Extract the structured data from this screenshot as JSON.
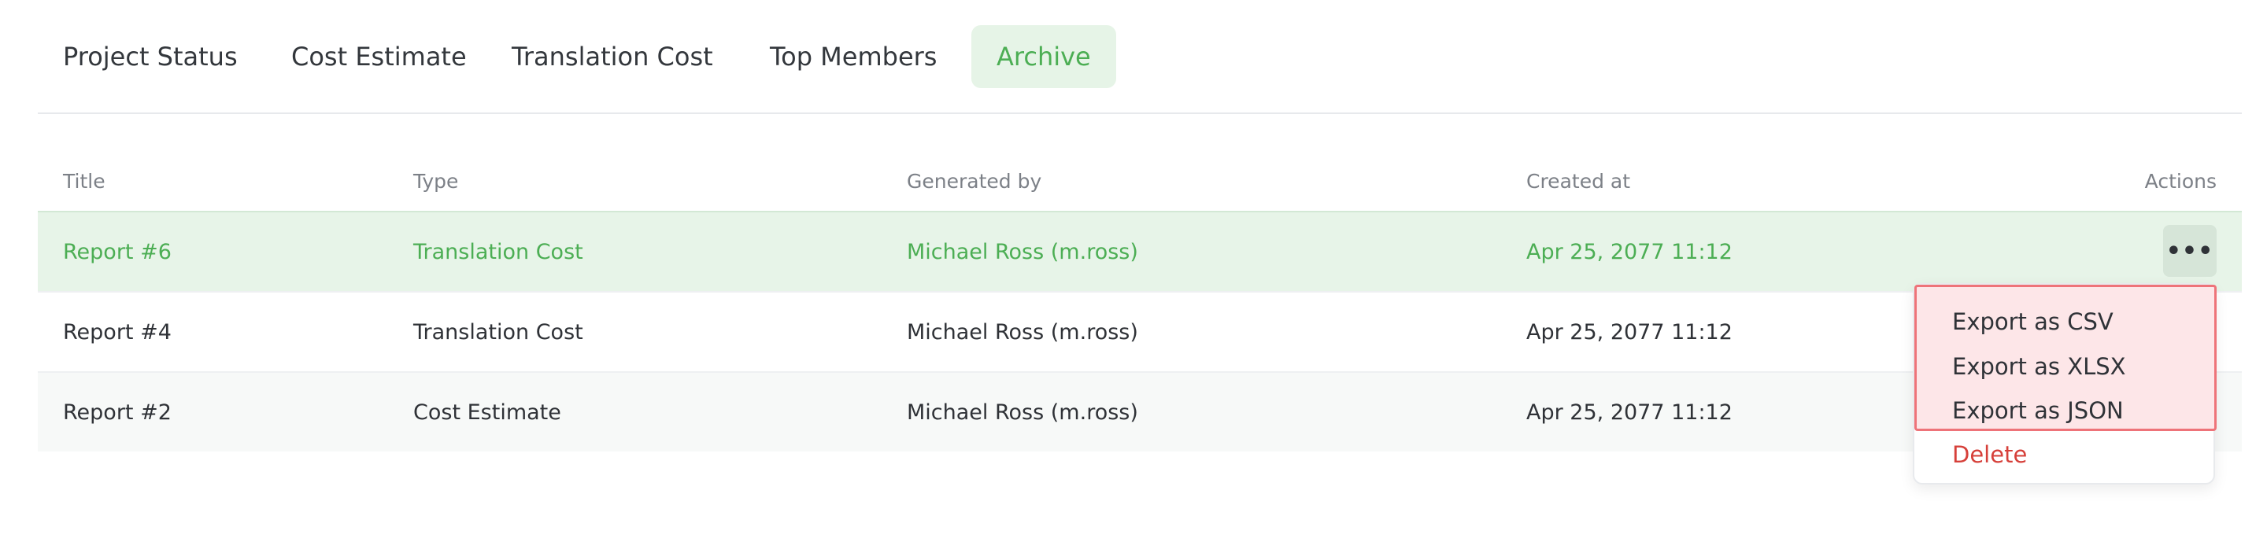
{
  "tabs": [
    {
      "label": "Project Status",
      "active": false
    },
    {
      "label": "Cost Estimate",
      "active": false
    },
    {
      "label": "Translation Cost",
      "active": false
    },
    {
      "label": "Top Members",
      "active": false
    },
    {
      "label": "Archive",
      "active": true
    }
  ],
  "table": {
    "columns": {
      "title": "Title",
      "type": "Type",
      "generated_by": "Generated by",
      "created_at": "Created at",
      "actions": "Actions"
    },
    "rows": [
      {
        "title": "Report #6",
        "type": "Translation Cost",
        "generated_by": "Michael Ross (m.ross)",
        "created_at": "Apr 25, 2077 11:12",
        "selected": true
      },
      {
        "title": "Report #4",
        "type": "Translation Cost",
        "generated_by": "Michael Ross (m.ross)",
        "created_at": "Apr 25, 2077 11:12",
        "selected": false
      },
      {
        "title": "Report #2",
        "type": "Cost Estimate",
        "generated_by": "Michael Ross (m.ross)",
        "created_at": "Apr 25, 2077 11:12",
        "selected": false
      }
    ],
    "actions_icon": "more-horizontal-icon",
    "actions_glyph": "•••"
  },
  "dropdown": {
    "items": [
      {
        "label": "Export as CSV"
      },
      {
        "label": "Export as XLSX"
      },
      {
        "label": "Export as JSON"
      },
      {
        "label": "Delete",
        "danger": true
      }
    ]
  },
  "colors": {
    "accent": "#4cae54",
    "accent_bg": "#e6f4e7",
    "danger": "#d6403a",
    "highlight_border": "#ee7379",
    "highlight_bg": "#fde6e8"
  }
}
